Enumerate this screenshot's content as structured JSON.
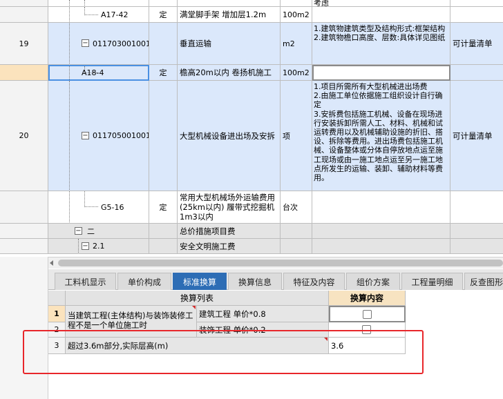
{
  "grid": {
    "top_cut_text": "考虑",
    "rows": [
      {
        "num": "",
        "code": "A17-42",
        "type": "定",
        "name": "满堂脚手架 增加层1.2m",
        "unit": "100m2",
        "features": "",
        "rule": ""
      },
      {
        "num": "19",
        "code": "011703001001",
        "type": "",
        "name": "垂直运输",
        "unit": "m2",
        "features": "1.建筑物建筑类型及结构形式:框架结构\n2.建筑物檐口高度、层数:具体详见图纸",
        "rule": "可计量清单"
      },
      {
        "num": "",
        "code": "A18-4",
        "type": "定",
        "name": "檐高20m以内 卷扬机施工",
        "unit": "100m2",
        "features": "",
        "rule": ""
      },
      {
        "num": "20",
        "code": "011705001001",
        "type": "",
        "name": "大型机械设备进出场及安拆",
        "unit": "项",
        "features": "1.项目所需所有大型机械进出场费\n2.由施工单位依据施工组织设计自行确定\n3.安拆费包括施工机械、设备在现场进行安装拆卸所需人工、材料、机械和试运转费用以及机械辅助设施的折旧、搭设、拆除等费用。进出场费包括施工机械、设备整体或分体自停放地点运至施工现场或由一施工地点运至另一施工地点所发生的运输、装卸、辅助材料等费用。",
        "rule": "可计量清单"
      },
      {
        "num": "",
        "code": "G5-16",
        "type": "定",
        "name": "常用大型机械场外运输费用(25km以内) 履带式挖掘机1m3以内",
        "unit": "台次",
        "features": "",
        "rule": ""
      },
      {
        "num": "",
        "code": "二",
        "type": "",
        "name": "总价措施项目费",
        "unit": "",
        "features": "",
        "rule": ""
      },
      {
        "num": "",
        "code": "2.1",
        "type": "",
        "name": "安全文明施工费",
        "unit": "",
        "features": "",
        "rule": ""
      }
    ]
  },
  "tabs": [
    {
      "label": "工料机显示"
    },
    {
      "label": "单价构成"
    },
    {
      "label": "标准换算"
    },
    {
      "label": "换算信息"
    },
    {
      "label": "特征及内容"
    },
    {
      "label": "组价方案"
    },
    {
      "label": "工程量明细"
    },
    {
      "label": "反查图形"
    }
  ],
  "active_tab": "标准换算",
  "conversion": {
    "header_list": "换算列表",
    "header_content": "换算内容",
    "group_label": "当建筑工程(主体结构)与装饰装修工程不是一个单位施工时",
    "rows": [
      {
        "num": "1",
        "label": "建筑工程 单价*0.8",
        "checked": false
      },
      {
        "num": "2",
        "label": "装饰工程 单价*0.2",
        "checked": false
      },
      {
        "num": "3",
        "label": "超过3.6m部分,实际层高(m)",
        "value": "3.6"
      }
    ]
  },
  "colors": {
    "active_tab": "#2d6db5",
    "blue_row": "#dbe8fb",
    "gray_row": "#e4e4e4",
    "highlight": "#e8262a"
  }
}
